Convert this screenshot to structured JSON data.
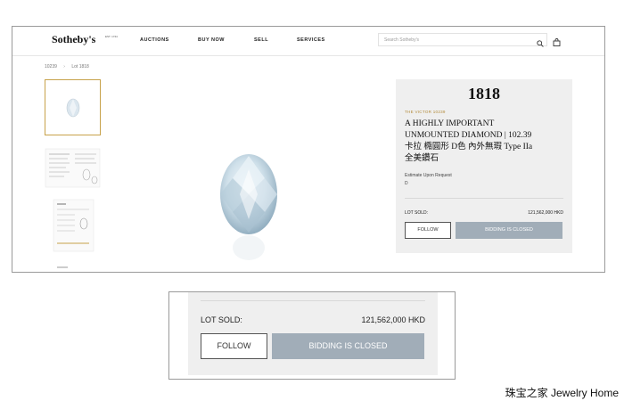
{
  "header": {
    "logo": "Sotheby's",
    "logo_since": "EST. 1744",
    "nav": [
      "AUCTIONS",
      "BUY NOW",
      "SELL",
      "SERVICES"
    ],
    "search_placeholder": "Search Sotheby's",
    "icons": [
      "search-icon",
      "shopping-bag-icon"
    ]
  },
  "breadcrumb": [
    "10239",
    "Lot 1818"
  ],
  "lot": {
    "number": "1818",
    "sale": "THE VICTOR 10239",
    "title_line1": "A HIGHLY IMPORTANT",
    "title_line2": "UNMOUNTED DIAMOND | 102.39",
    "title_line3": "卡拉 橢圓形 D色 內外無瑕 Type IIa",
    "title_line4": "全美鑽石",
    "estimate_label": "Estimate Upon Request",
    "estimate_value": "D",
    "sold_label": "LOT SOLD:",
    "sold_value": "121,562,000 HKD",
    "follow_label": "FOLLOW",
    "closed_label": "BIDDING IS CLOSED"
  },
  "colors": {
    "accent_gold": "#b28a3a",
    "closed_button": "#a1adb8",
    "panel_bg": "#efefef"
  },
  "watermark": "珠宝之家 Jewelry Home"
}
